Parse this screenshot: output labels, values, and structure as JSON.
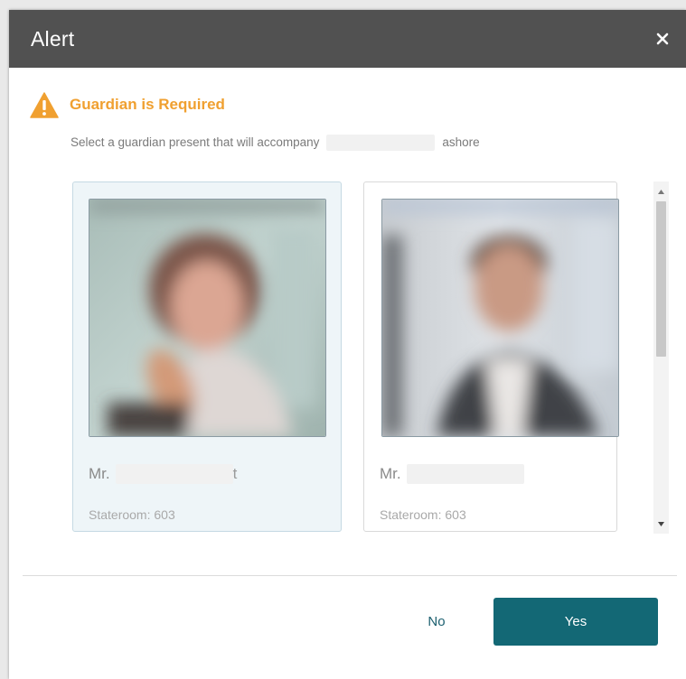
{
  "dialog": {
    "title": "Alert",
    "close_icon": "close-icon",
    "heading": "Guardian is Required",
    "warning_icon": "warning-icon",
    "message_prefix": "Select a guardian present that will accompany",
    "message_suffix": "ashore"
  },
  "guardians": [
    {
      "salutation": "Mr.",
      "name_suffix": "t",
      "stateroom": "Stateroom: 603",
      "selected": true
    },
    {
      "salutation": "Mr.",
      "name_suffix": "",
      "stateroom": "Stateroom: 603",
      "selected": false
    }
  ],
  "buttons": {
    "no_label": "No",
    "yes_label": "Yes"
  },
  "colors": {
    "titlebar": "#515151",
    "heading": "#f0a030",
    "primary_button": "#136875",
    "selected_card": "#eef5f8"
  }
}
